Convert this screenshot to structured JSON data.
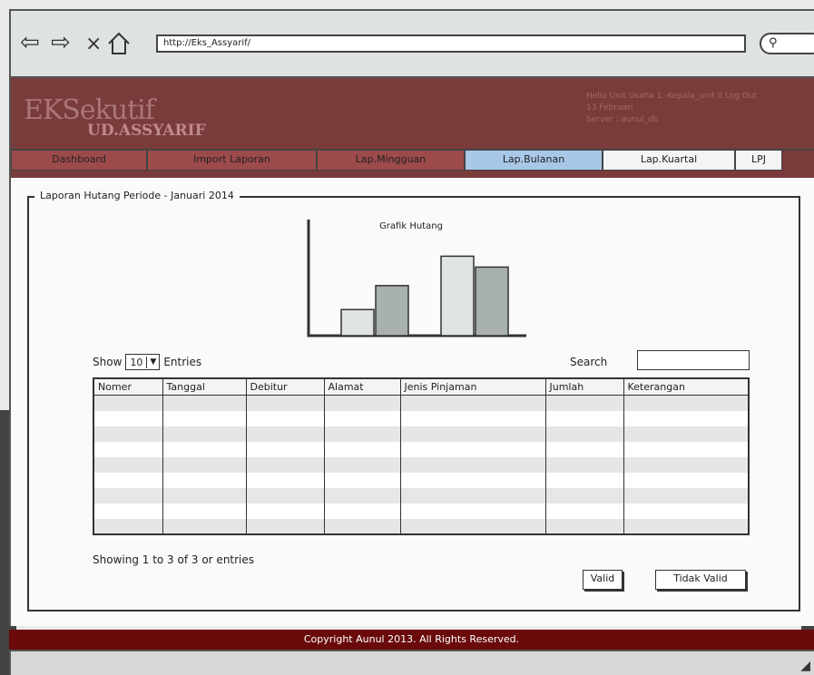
{
  "browser": {
    "url": "http://Eks_Assyarif/",
    "back_icon": "back-arrow-icon",
    "forward_icon": "forward-arrow-icon",
    "stop_glyph": "×"
  },
  "header": {
    "logo_main": "EKSekutif",
    "logo_sub": "UD.ASSYARIF",
    "user_line": "Hello Unit Usaha 1 -Kepala_unit II Log Out",
    "date_line": "13 Februari",
    "server_line": "Server : aunul_db"
  },
  "nav": {
    "tabs": [
      {
        "label": "Dashboard"
      },
      {
        "label": "Import Laporan"
      },
      {
        "label": "Lap.Mingguan"
      },
      {
        "label": "Lap.Bulanan"
      },
      {
        "label": "Lap.Kuartal"
      },
      {
        "label": "LPJ"
      }
    ]
  },
  "report": {
    "legend": "Laporan Hutang Periode - Januari 2014",
    "show_prefix": "Show",
    "show_value": "10",
    "show_suffix": "Entries",
    "search_label": "Search",
    "search_value": "",
    "showing_text": "Showing 1 to 3 of 3 or entries",
    "valid_label": "Valid",
    "invalid_label": "Tidak Valid"
  },
  "table": {
    "headers": [
      "Nomer",
      "Tanggal",
      "Debitur",
      "Alamat",
      "Jenis Pinjaman",
      "Jumlah",
      "Keterangan"
    ]
  },
  "chart_data": {
    "type": "bar",
    "title": "Grafik Hutang",
    "xlabel": "",
    "ylabel": "",
    "series": [
      {
        "values": [
          0.24,
          0.46,
          0.73,
          0.63
        ]
      }
    ],
    "colors": [
      "#dfe4e0",
      "#a9b1ad",
      "#dfe4e0",
      "#a9b1ad"
    ]
  },
  "footer": {
    "copyright": "Copyright Aunul 2013. All Rights Reserved."
  },
  "colors": {
    "header_bg": "#7a3b3b",
    "active_tab": "#a9c8e8",
    "footer_bg": "#6a0a0a"
  }
}
